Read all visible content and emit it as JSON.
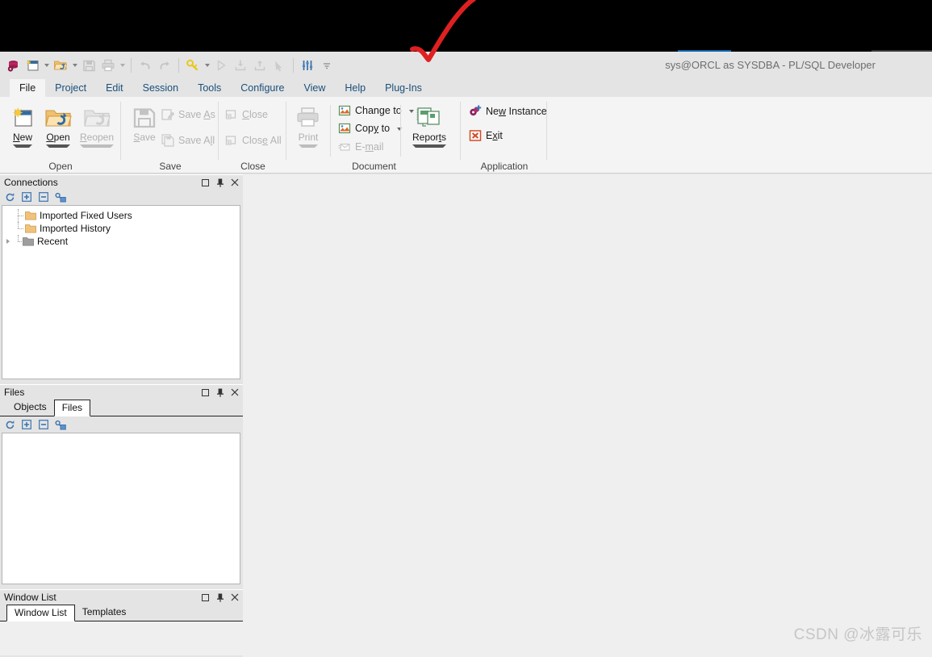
{
  "window": {
    "title": "sys@ORCL as SYSDBA - PL/SQL Developer",
    "accent_color": "#0a64ad"
  },
  "quick_access": {
    "items": [
      {
        "name": "database-icon",
        "label": "Database"
      },
      {
        "name": "new-icon",
        "label": "New",
        "has_arrow": true
      },
      {
        "name": "open-icon",
        "label": "Open",
        "has_arrow": true
      },
      {
        "name": "save-icon",
        "label": "Save",
        "disabled": true
      },
      {
        "name": "print-icon",
        "label": "Print",
        "disabled": true,
        "has_arrow": true
      },
      {
        "name": "undo-icon",
        "label": "Undo",
        "disabled": true
      },
      {
        "name": "redo-icon",
        "label": "Redo",
        "disabled": true
      },
      {
        "name": "key-icon",
        "label": "Login",
        "has_arrow": true
      },
      {
        "name": "execute-icon",
        "label": "Execute",
        "disabled": true
      },
      {
        "name": "commit-icon",
        "label": "Commit",
        "disabled": true
      },
      {
        "name": "rollback-icon",
        "label": "Rollback",
        "disabled": true
      },
      {
        "name": "break-icon",
        "label": "Break",
        "disabled": true
      },
      {
        "name": "preferences-icon",
        "label": "Preferences"
      },
      {
        "name": "customize-toolbar-icon",
        "label": "Customize"
      }
    ]
  },
  "ribbon": {
    "tabs": [
      {
        "label": "File",
        "active": true
      },
      {
        "label": "Project",
        "active": false
      },
      {
        "label": "Edit",
        "active": false
      },
      {
        "label": "Session",
        "active": false
      },
      {
        "label": "Tools",
        "active": false
      },
      {
        "label": "Configure",
        "active": false
      },
      {
        "label": "View",
        "active": false
      },
      {
        "label": "Help",
        "active": false
      },
      {
        "label": "Plug-Ins",
        "active": false
      }
    ],
    "groups": [
      {
        "name": "open",
        "label": "Open"
      },
      {
        "name": "save",
        "label": "Save"
      },
      {
        "name": "close",
        "label": "Close"
      },
      {
        "name": "document",
        "label": "Document"
      },
      {
        "name": "application",
        "label": "Application"
      }
    ],
    "buttons": {
      "new": "New",
      "open": "Open",
      "reopen": "Reopen",
      "save": "Save",
      "save_as": "Save As",
      "save_all": "Save All",
      "close": "Close",
      "close_all": "Close All",
      "print": "Print",
      "change_to": "Change to",
      "copy_to": "Copy to",
      "email": "E-mail",
      "reports": "Reports",
      "new_instance": "New Instance",
      "exit": "Exit"
    }
  },
  "panels": {
    "connections": {
      "title": "Connections",
      "toolbar": [
        {
          "name": "refresh-icon",
          "label": "Refresh"
        },
        {
          "name": "expand-all-icon",
          "label": "Expand All"
        },
        {
          "name": "collapse-all-icon",
          "label": "Collapse All"
        },
        {
          "name": "configure-connections-icon",
          "label": "Configure"
        }
      ],
      "tree": [
        {
          "label": "Imported Fixed Users",
          "icon": "folder-icon",
          "expandable": false
        },
        {
          "label": "Imported History",
          "icon": "folder-icon",
          "expandable": false
        },
        {
          "label": "Recent",
          "icon": "folder-grey-icon",
          "expandable": true
        }
      ]
    },
    "files": {
      "title": "Files",
      "tabs": [
        {
          "label": "Objects",
          "active": false
        },
        {
          "label": "Files",
          "active": true
        }
      ],
      "toolbar": [
        {
          "name": "refresh-icon",
          "label": "Refresh"
        },
        {
          "name": "expand-all-icon",
          "label": "Expand All"
        },
        {
          "name": "collapse-all-icon",
          "label": "Collapse All"
        },
        {
          "name": "configure-files-icon",
          "label": "Configure"
        }
      ]
    },
    "window_list": {
      "title": "Window List",
      "tabs": [
        {
          "label": "Window List",
          "active": true
        },
        {
          "label": "Templates",
          "active": false
        }
      ]
    },
    "caption_buttons": [
      {
        "name": "maximize-icon",
        "glyph": "□"
      },
      {
        "name": "pin-icon",
        "glyph": "📌"
      },
      {
        "name": "close-icon",
        "glyph": "✕"
      }
    ]
  },
  "annotation": {
    "name": "red-checkmark",
    "color": "#e02020"
  },
  "watermark": "CSDN @冰露可乐"
}
